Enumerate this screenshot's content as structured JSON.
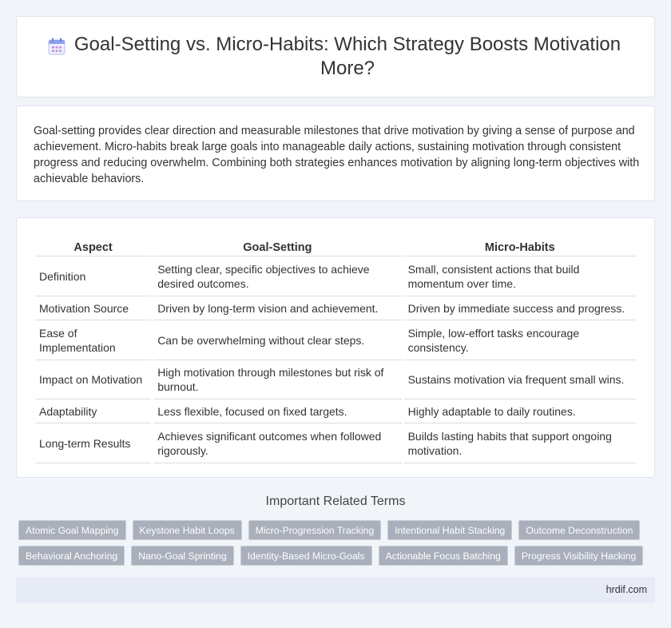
{
  "header": {
    "title": "Goal-Setting vs. Micro-Habits: Which Strategy Boosts Motivation More?",
    "icon": "calendar-icon"
  },
  "intro": {
    "text": "Goal-setting provides clear direction and measurable milestones that drive motivation by giving a sense of purpose and achievement. Micro-habits break large goals into manageable daily actions, sustaining motivation through consistent progress and reducing overwhelm. Combining both strategies enhances motivation by aligning long-term objectives with achievable behaviors."
  },
  "table": {
    "headers": [
      "Aspect",
      "Goal-Setting",
      "Micro-Habits"
    ],
    "rows": [
      [
        "Definition",
        "Setting clear, specific objectives to achieve desired outcomes.",
        "Small, consistent actions that build momentum over time."
      ],
      [
        "Motivation Source",
        "Driven by long-term vision and achievement.",
        "Driven by immediate success and progress."
      ],
      [
        "Ease of Implementation",
        "Can be overwhelming without clear steps.",
        "Simple, low-effort tasks encourage consistency."
      ],
      [
        "Impact on Motivation",
        "High motivation through milestones but risk of burnout.",
        "Sustains motivation via frequent small wins."
      ],
      [
        "Adaptability",
        "Less flexible, focused on fixed targets.",
        "Highly adaptable to daily routines."
      ],
      [
        "Long-term Results",
        "Achieves significant outcomes when followed rigorously.",
        "Builds lasting habits that support ongoing motivation."
      ]
    ]
  },
  "related": {
    "title": "Important Related Terms",
    "row1": [
      "Atomic Goal Mapping",
      "Keystone Habit Loops",
      "Micro-Progression Tracking",
      "Intentional Habit Stacking",
      "Outcome Deconstruction"
    ],
    "row2": [
      "Behavioral Anchoring",
      "Nano-Goal Sprinting",
      "Identity-Based Micro-Goals",
      "Actionable Focus Batching",
      "Progress Visibility Hacking"
    ]
  },
  "footer": {
    "site": "hrdif.com"
  },
  "colors": {
    "background": "#f1f4f9",
    "tag": "#a9afbb",
    "footer": "#e6ebf6",
    "icon_accent": "#7b8fe8"
  }
}
